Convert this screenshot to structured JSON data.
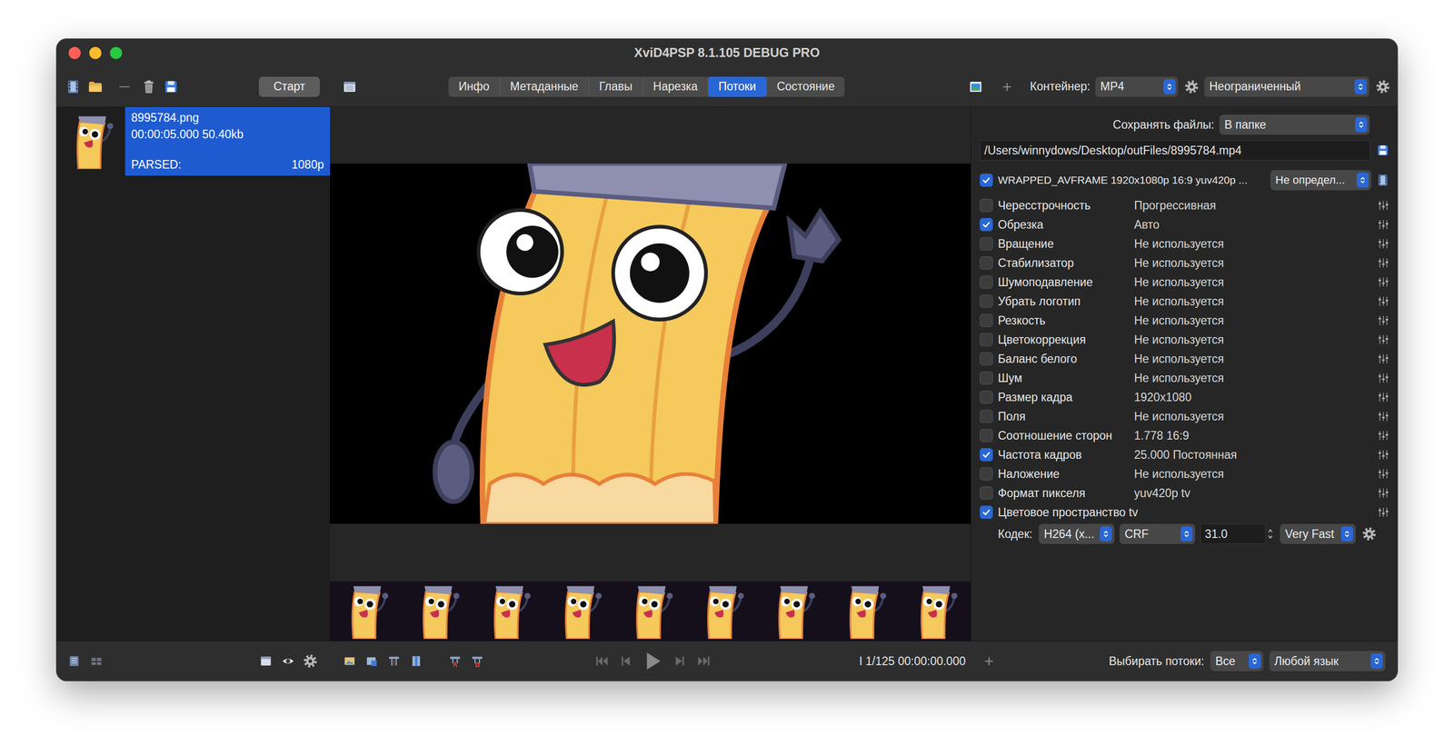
{
  "window": {
    "title": "XviD4PSP 8.1.105 DEBUG PRO"
  },
  "toolbar": {
    "start_button": "Старт",
    "tabs": [
      {
        "label": "Инфо",
        "selected": false
      },
      {
        "label": "Метаданные",
        "selected": false
      },
      {
        "label": "Главы",
        "selected": false
      },
      {
        "label": "Нарезка",
        "selected": false
      },
      {
        "label": "Потоки",
        "selected": true
      },
      {
        "label": "Состояние",
        "selected": false
      }
    ],
    "add": "+",
    "container_label": "Контейнер:",
    "container": "MP4",
    "preset": "Неограниченный"
  },
  "files": [
    {
      "name": "8995784.png",
      "info": "00:00:05.000 50.40kb",
      "status": "PARSED:",
      "resolution": "1080p",
      "selected": true
    }
  ],
  "output": {
    "save_label": "Сохранять файлы:",
    "save_mode": "В папке",
    "path": "/Users/winnydows/Desktop/outFiles/8995784.mp4"
  },
  "stream": {
    "checked": true,
    "description": "WRAPPED_AVFRAME 1920x1080p 16:9 yuv420p ...",
    "mode": "Не определ..."
  },
  "filters": [
    {
      "label": "Чересстрочность",
      "value": "Прогрессивная",
      "checked": false
    },
    {
      "label": "Обрезка",
      "value": "Авто",
      "checked": true
    },
    {
      "label": "Вращение",
      "value": "Не используется",
      "checked": false
    },
    {
      "label": "Стабилизатор",
      "value": "Не используется",
      "checked": false
    },
    {
      "label": "Шумоподавление",
      "value": "Не используется",
      "checked": false
    },
    {
      "label": "Убрать логотип",
      "value": "Не используется",
      "checked": false
    },
    {
      "label": "Резкость",
      "value": "Не используется",
      "checked": false
    },
    {
      "label": "Цветокоррекция",
      "value": "Не используется",
      "checked": false
    },
    {
      "label": "Баланс белого",
      "value": "Не используется",
      "checked": false
    },
    {
      "label": "Шум",
      "value": "Не используется",
      "checked": false
    },
    {
      "label": "Размер кадра",
      "value": "1920x1080",
      "checked": false
    },
    {
      "label": "Поля",
      "value": "Не используется",
      "checked": false
    },
    {
      "label": "Соотношение сторон",
      "value": "1.778 16:9",
      "checked": false
    },
    {
      "label": "Частота кадров",
      "value": "25.000 Постоянная",
      "checked": true
    },
    {
      "label": "Наложение",
      "value": "Не используется",
      "checked": false
    },
    {
      "label": "Формат пикселя",
      "value": "yuv420p tv",
      "checked": false
    },
    {
      "label": "Цветовое пространство tv",
      "checked": true
    }
  ],
  "codec": {
    "label": "Кодек:",
    "codec": "H264 (x...",
    "mode": "CRF",
    "value": "31.0",
    "preset": "Very Fast"
  },
  "status_bar": {
    "position": "I 1/125 00:00:00.000",
    "add": "+",
    "streams_label": "Выбирать потоки:",
    "streams": "Все",
    "language": "Любой язык"
  }
}
